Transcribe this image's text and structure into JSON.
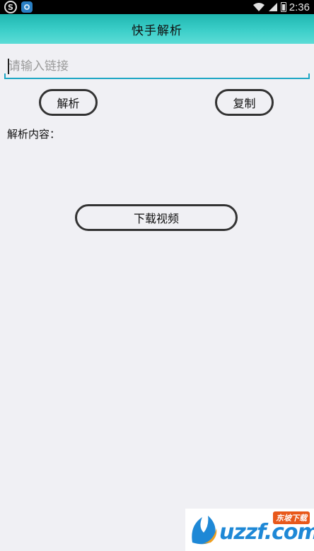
{
  "status_bar": {
    "time": "2:36",
    "left_icons": [
      "sogou-icon",
      "app-icon"
    ],
    "right_icons": [
      "wifi-icon",
      "signal-icon",
      "battery-icon"
    ]
  },
  "title_bar": {
    "title": "快手解析",
    "gradient_colors": [
      "#1fb6b0",
      "#5cdcd6"
    ]
  },
  "link_input": {
    "value": "",
    "placeholder": "请输入链接"
  },
  "buttons": {
    "parse": "解析",
    "copy": "复制",
    "download": "下载视频"
  },
  "result": {
    "label": "解析内容："
  },
  "watermark": {
    "text": "uzzf.com",
    "badge": "东坡下载"
  },
  "colors": {
    "background": "#f0f0f4",
    "accent": "#1ca6c4",
    "button_border": "#333333"
  }
}
